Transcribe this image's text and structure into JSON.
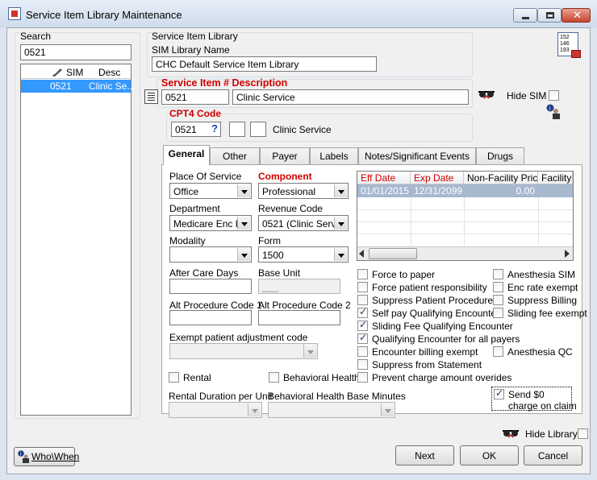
{
  "window": {
    "title": "Service Item Library Maintenance",
    "icon": "app-icon"
  },
  "search": {
    "label": "Search",
    "value": "0521",
    "columns": [
      "SIM",
      "Desc"
    ],
    "rows": [
      {
        "sim": "0521",
        "desc": "Clinic Se..."
      }
    ]
  },
  "library": {
    "group_label": "Service Item Library",
    "name_label": "SIM Library Name",
    "name_value": "CHC Default Service Item Library",
    "book_icon_lines": [
      "152",
      "146",
      "193"
    ]
  },
  "service_item": {
    "label": "Service Item # Description",
    "number": "0521",
    "description": "Clinic Service",
    "hide_label": "Hide SIM",
    "hide_checked": false
  },
  "cpt4": {
    "label": "CPT4 Code",
    "code": "0521",
    "help_glyph": "?",
    "description": "Clinic Service"
  },
  "tabs": [
    "General",
    "Other",
    "Payer",
    "Labels",
    "Notes/Significant Events",
    "Drugs"
  ],
  "active_tab": "General",
  "general": {
    "place_of_service": {
      "label": "Place Of Service",
      "value": "Office"
    },
    "component": {
      "label": "Component",
      "value": "Professional"
    },
    "department": {
      "label": "Department",
      "value": "Medicare Enc F"
    },
    "revenue_code": {
      "label": "Revenue Code",
      "value": "0521 (Clinic Servi"
    },
    "modality": {
      "label": "Modality",
      "value": ""
    },
    "form": {
      "label": "Form",
      "value": "1500"
    },
    "after_care_days": {
      "label": "After Care Days",
      "value": ""
    },
    "base_unit": {
      "label": "Base Unit",
      "value": "___"
    },
    "alt_code_1": {
      "label": "Alt Procedure Code 1",
      "value": ""
    },
    "alt_code_2": {
      "label": "Alt Procedure Code 2",
      "value": ""
    },
    "exempt_code": {
      "label": "Exempt patient adjustment code",
      "value": ""
    },
    "rental": {
      "label": "Rental",
      "checked": false
    },
    "behavioral": {
      "label": "Behavioral Health",
      "checked": false
    },
    "rental_duration": {
      "label": "Rental Duration per Unit",
      "value": ""
    },
    "behavioral_minutes": {
      "label": "Behavioral Health Base Minutes",
      "value": ""
    }
  },
  "price_grid": {
    "columns": [
      "Eff Date",
      "Exp Date",
      "Non-Facility Price",
      "Facility F"
    ],
    "rows": [
      {
        "eff": "01/01/2015",
        "exp": "12/31/2099",
        "price": "0.00",
        "facility": ""
      }
    ]
  },
  "checkboxes_left": [
    {
      "label": "Force to paper",
      "checked": false
    },
    {
      "label": "Force patient responsibility",
      "checked": false
    },
    {
      "label": "Suppress Patient Procedure",
      "checked": false
    },
    {
      "label": "Self pay Qualifying Encounter",
      "checked": true
    },
    {
      "label": "Sliding Fee Qualifying Encounter",
      "checked": true
    },
    {
      "label": "Qualifying Encounter for all payers",
      "checked": true
    },
    {
      "label": "Encounter billing exempt",
      "checked": false
    },
    {
      "label": "Suppress from Statement",
      "checked": false
    },
    {
      "label": "Prevent charge amount overides",
      "checked": false
    }
  ],
  "checkboxes_right": [
    {
      "label": "Anesthesia SIM",
      "checked": false
    },
    {
      "label": "Enc rate exempt",
      "checked": false
    },
    {
      "label": "Suppress Billing",
      "checked": false
    },
    {
      "label": "Sliding fee exempt",
      "checked": false
    },
    {
      "label": "Anesthesia QC",
      "checked": false
    }
  ],
  "send_zero": {
    "line1": "Send $0",
    "line2": "charge on claim",
    "checked": true
  },
  "hide_library": {
    "label": "Hide Library",
    "checked": false
  },
  "buttons": {
    "who_when": "Who\\When",
    "next": "Next",
    "ok": "OK",
    "cancel": "Cancel"
  },
  "colors": {
    "required_label": "#d00000",
    "selection": "#3399ff",
    "grid_selection": "#a7b8cf"
  }
}
